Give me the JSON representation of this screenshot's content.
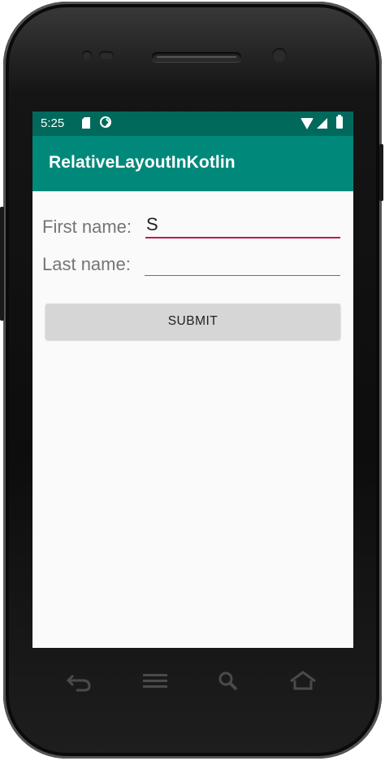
{
  "status_bar": {
    "time": "5:25",
    "left_icons": [
      "sd-card-icon",
      "sync-icon"
    ],
    "right_icons": [
      "wifi-icon",
      "signal-icon",
      "battery-icon"
    ]
  },
  "app_bar": {
    "title": "RelativeLayoutInKotlin"
  },
  "form": {
    "first_name_label": "First name:",
    "first_name_value": "S",
    "last_name_label": "Last name:",
    "last_name_value": "",
    "submit_label": "SUBMIT"
  },
  "nav_keys": [
    "back-icon",
    "menu-icon",
    "search-icon",
    "home-icon"
  ],
  "colors": {
    "status_bar": "#00695c",
    "app_bar": "#00897b",
    "focus_underline": "#c2185b",
    "button_bg": "#d6d6d6"
  }
}
